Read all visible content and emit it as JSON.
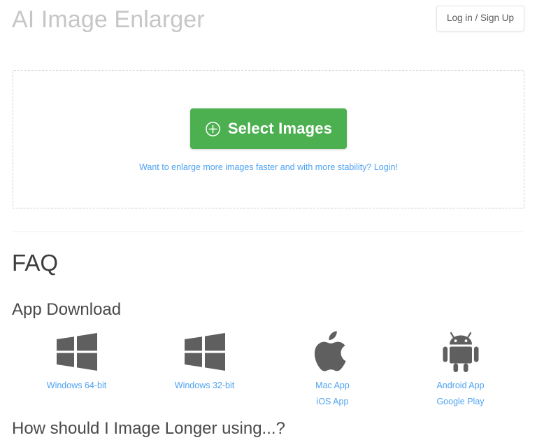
{
  "header": {
    "title": "AI Image Enlarger",
    "login_button": "Log in / Sign Up"
  },
  "upload": {
    "select_button_label": "Select Images",
    "plus_icon": "plus-circle-icon",
    "hint_text": "Want to enlarge more images faster and with more stability? Login!"
  },
  "faq": {
    "title": "FAQ",
    "app_download_heading": "App Download",
    "next_question": "How should I Image Longer using...?"
  },
  "downloads": [
    {
      "icon": "windows-logo-icon",
      "links": [
        "Windows 64-bit"
      ]
    },
    {
      "icon": "windows-logo-icon",
      "links": [
        "Windows 32-bit"
      ]
    },
    {
      "icon": "apple-logo-icon",
      "links": [
        "Mac App",
        "iOS App"
      ]
    },
    {
      "icon": "android-logo-icon",
      "links": [
        "Android App",
        "Google Play"
      ]
    }
  ],
  "colors": {
    "accent_green": "#4cb050",
    "link_blue": "#4fa3f2",
    "title_gray": "#c6c6c6",
    "icon_gray": "#5f5f5f",
    "dashed_border": "#cfcfcf"
  }
}
